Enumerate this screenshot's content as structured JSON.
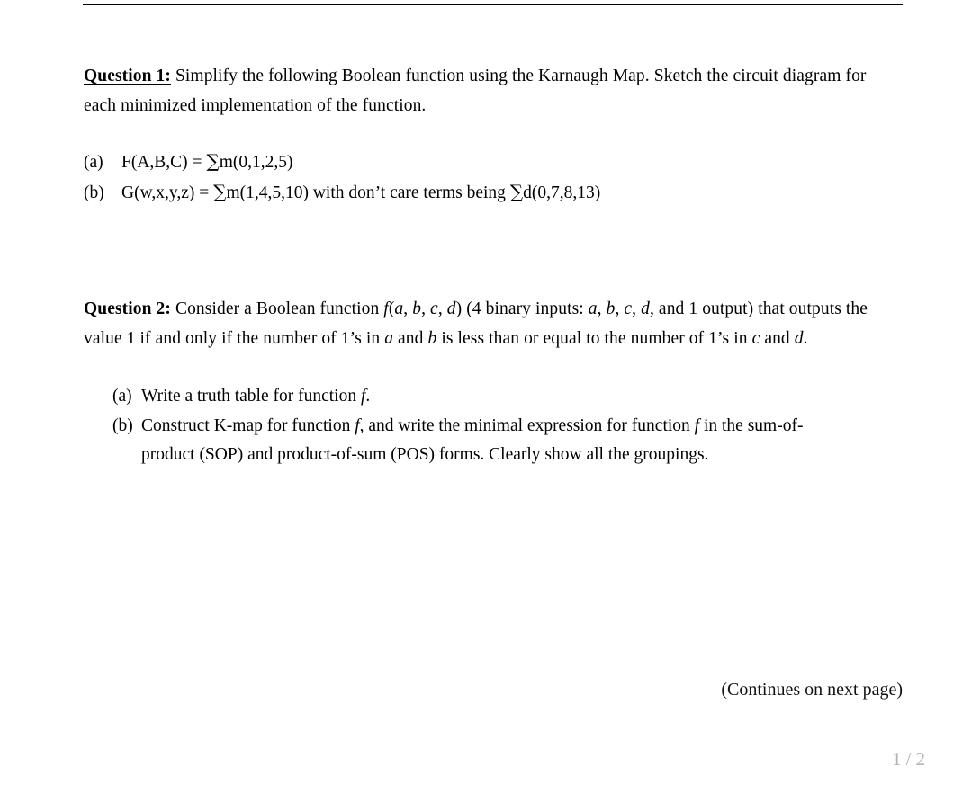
{
  "document": {
    "top_rule": true,
    "question1": {
      "label": "Question 1:",
      "body": " Simplify the following Boolean function using the Karnaugh Map. Sketch the circuit diagram for each minimized implementation of the function.",
      "items": [
        {
          "marker": "(a)",
          "text_before": "F(A,B,C) = ",
          "sigma": "∑",
          "text_after": "m(0,1,2,5)"
        },
        {
          "marker": "(b)",
          "text_before": "G(w,x,y,z) = ",
          "sigma": "∑",
          "text_mid": "m(1,4,5,10) with don’t care terms being ",
          "sigma2": "∑",
          "text_after": "d(0,7,8,13)"
        }
      ]
    },
    "question2": {
      "label": "Question 2:",
      "body_p1": " Consider a Boolean function ",
      "fn_f": "f",
      "fn_args_open": "(",
      "var_a": "a",
      "sep1": ", ",
      "var_b": "b",
      "sep2": ", ",
      "var_c": "c",
      "sep3": ", ",
      "var_d": "d",
      "fn_args_close": ")",
      "body_p2": " (4 binary inputs: ",
      "body_p3": ", and 1 output) that outputs the value 1 if and only if the number of 1’s in ",
      "body_p4": " and ",
      "body_p5": " is less than or equal to the number of 1’s in ",
      "body_p6": " and ",
      "body_p7": ".",
      "items": [
        {
          "marker": "(a)",
          "part1": "Write a truth table for function ",
          "ital1": "f",
          "part2": "."
        },
        {
          "marker": "(b)",
          "part1": "Construct K-map for function ",
          "ital1": "f",
          "part2": ", and write the minimal expression for function ",
          "ital2": "f",
          "part3": " in the sum-of-product (SOP) and product-of-sum (POS) forms. Clearly show all the groupings."
        }
      ]
    },
    "footer": {
      "continues_note": "(Continues on next page)"
    }
  },
  "viewer": {
    "current_page": "1",
    "separator": "/",
    "total_pages": "2",
    "indicator_color": "#b3b3b3"
  }
}
